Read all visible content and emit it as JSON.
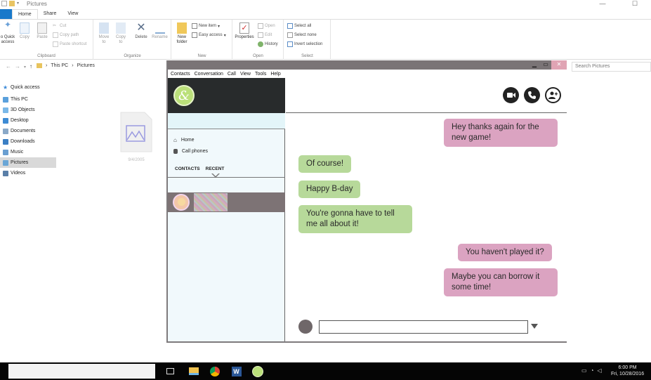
{
  "explorer": {
    "title": "Pictures",
    "tabs": {
      "file": "",
      "home": "Home",
      "share": "Share",
      "view": "View"
    },
    "ribbon": {
      "clipboard": {
        "pin_label": "o Quick\naccess",
        "copy": "Copy",
        "paste": "Paste",
        "cut": "Cut",
        "copy_path": "Copy path",
        "paste_shortcut": "Paste shortcut",
        "group": "Clipboard"
      },
      "organize": {
        "move_to": "Move\nto",
        "copy_to": "Copy\nto",
        "delete": "Delete",
        "rename": "Rename",
        "group": "Organize"
      },
      "new": {
        "new_folder": "New\nfolder",
        "new_item": "New item",
        "easy_access": "Easy access",
        "group": "New"
      },
      "open": {
        "properties": "Properties",
        "open": "Open",
        "edit": "Edit",
        "history": "History",
        "group": "Open"
      },
      "select": {
        "select_all": "Select all",
        "select_none": "Select none",
        "invert_selection": "Invert selection",
        "group": "Select"
      }
    },
    "address": {
      "this_pc": "This PC",
      "pictures": "Pictures"
    },
    "search_placeholder": "Search Pictures",
    "nav": {
      "quick_access": "Quick access",
      "this_pc": "This PC",
      "objects_3d": "3D Objects",
      "desktop": "Desktop",
      "documents": "Documents",
      "downloads": "Downloads",
      "music": "Music",
      "pictures": "Pictures",
      "videos": "Videos"
    },
    "file": {
      "name": "9/4/2005"
    }
  },
  "skype": {
    "menu": {
      "contacts": "Contacts",
      "conversation": "Conversation",
      "call": "Call",
      "view": "View",
      "tools": "Tools",
      "help": "Help"
    },
    "logo_glyph": "&",
    "nav": {
      "home": "Home",
      "call_phones": "Call phones"
    },
    "tabs": {
      "contacts": "CONTACTS",
      "recent": "RECENT"
    },
    "messages": {
      "m1": "Hey thanks again for the new game!",
      "m2": "Of course!",
      "m3": "Happy B-day",
      "m4": "You're gonna have to tell me all about it!",
      "m5": "You haven't played it?",
      "m6": "Maybe you can borrow it some time!"
    },
    "colors": {
      "outgoing": "#dba3c1",
      "incoming": "#b7d99a",
      "profile_bg": "#282b2c"
    }
  },
  "taskbar": {
    "time": "6:00 PM",
    "date": "Fri, 10/28/2016"
  }
}
